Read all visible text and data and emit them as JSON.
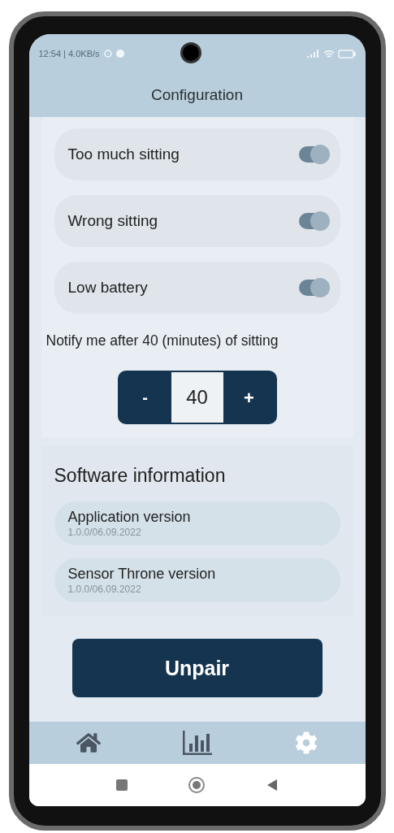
{
  "status_bar": {
    "text": "12:54 | 4.0KB/s"
  },
  "header": {
    "title": "Configuration"
  },
  "toggles": [
    {
      "label": "Too much sitting",
      "on": true
    },
    {
      "label": "Wrong sitting",
      "on": true
    },
    {
      "label": "Low battery",
      "on": true
    }
  ],
  "notify": {
    "text": "Notify me after 40 (minutes) of sitting",
    "decrement": "-",
    "value": "40",
    "increment": "+"
  },
  "software": {
    "title": "Software information",
    "items": [
      {
        "label": "Application version",
        "value": "1.0.0/06.09.2022"
      },
      {
        "label": "Sensor Throne version",
        "value": "1.0.0/06.09.2022"
      }
    ]
  },
  "unpair_button": "Unpair",
  "bottom_nav": [
    {
      "kind": "home",
      "selected": false
    },
    {
      "kind": "stats",
      "selected": false
    },
    {
      "kind": "settings",
      "selected": true
    }
  ]
}
